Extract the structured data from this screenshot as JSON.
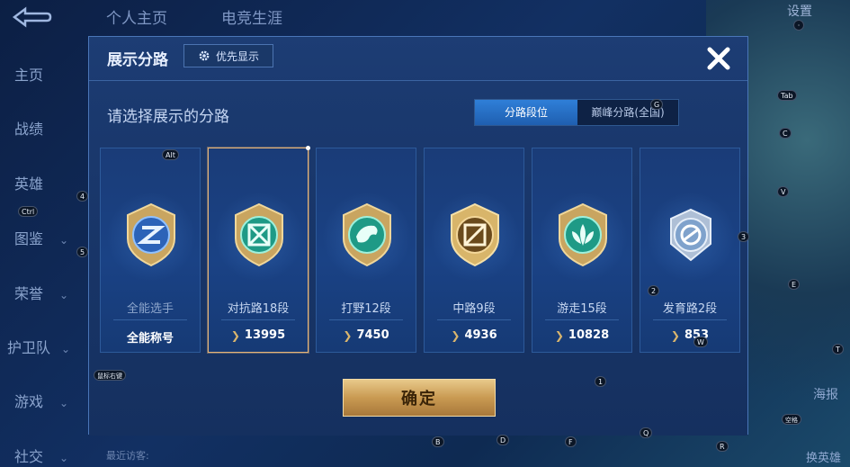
{
  "background": {
    "top_tabs": [
      "个人主页",
      "电竞生涯"
    ],
    "settings_label": "设置",
    "left_nav": [
      "主页",
      "战绩",
      "英雄",
      "图鉴",
      "荣誉",
      "护卫队",
      "游戏",
      "社交"
    ],
    "recent_visitors": "最近访客:",
    "right_labels": {
      "haibao": "海报",
      "huan_yingxiong": "换英雄"
    }
  },
  "dialog": {
    "title": "展示分路",
    "pref_button": "优先显示",
    "subtitle": "请选择展示的分路",
    "tabs": [
      {
        "label": "分路段位",
        "active": true
      },
      {
        "label": "巅峰分路(全国)",
        "active": false
      }
    ],
    "cards": [
      {
        "lane": "全能选手",
        "value": "全能称号",
        "selected": false,
        "icon": "all-round-emblem"
      },
      {
        "lane": "对抗路18段",
        "value": "13995",
        "selected": true,
        "icon": "clash-lane-emblem"
      },
      {
        "lane": "打野12段",
        "value": "7450",
        "selected": false,
        "icon": "jungle-emblem"
      },
      {
        "lane": "中路9段",
        "value": "4936",
        "selected": false,
        "icon": "mid-lane-emblem"
      },
      {
        "lane": "游走15段",
        "value": "10828",
        "selected": false,
        "icon": "roam-emblem"
      },
      {
        "lane": "发育路2段",
        "value": "853",
        "selected": false,
        "icon": "farm-lane-emblem"
      }
    ],
    "confirm_label": "确定"
  },
  "key_hints": {
    "alt": "Alt",
    "ctrl": "Ctrl",
    "g": "G",
    "tab": "Tab",
    "c": "C",
    "v": "V",
    "n3": "3",
    "n4": "4",
    "n5": "5",
    "n2": "2",
    "w": "W",
    "e": "E",
    "n1": "1",
    "t": "T",
    "space": "空格",
    "q": "Q",
    "b": "B",
    "d": "D",
    "f": "F",
    "r": "R",
    "right_click": "鼠标右键",
    "dot": "·"
  },
  "colors": {
    "accent_blue": "#2f7fd8",
    "gold": "#d9b56d",
    "selected_border": "#e3b47a"
  }
}
